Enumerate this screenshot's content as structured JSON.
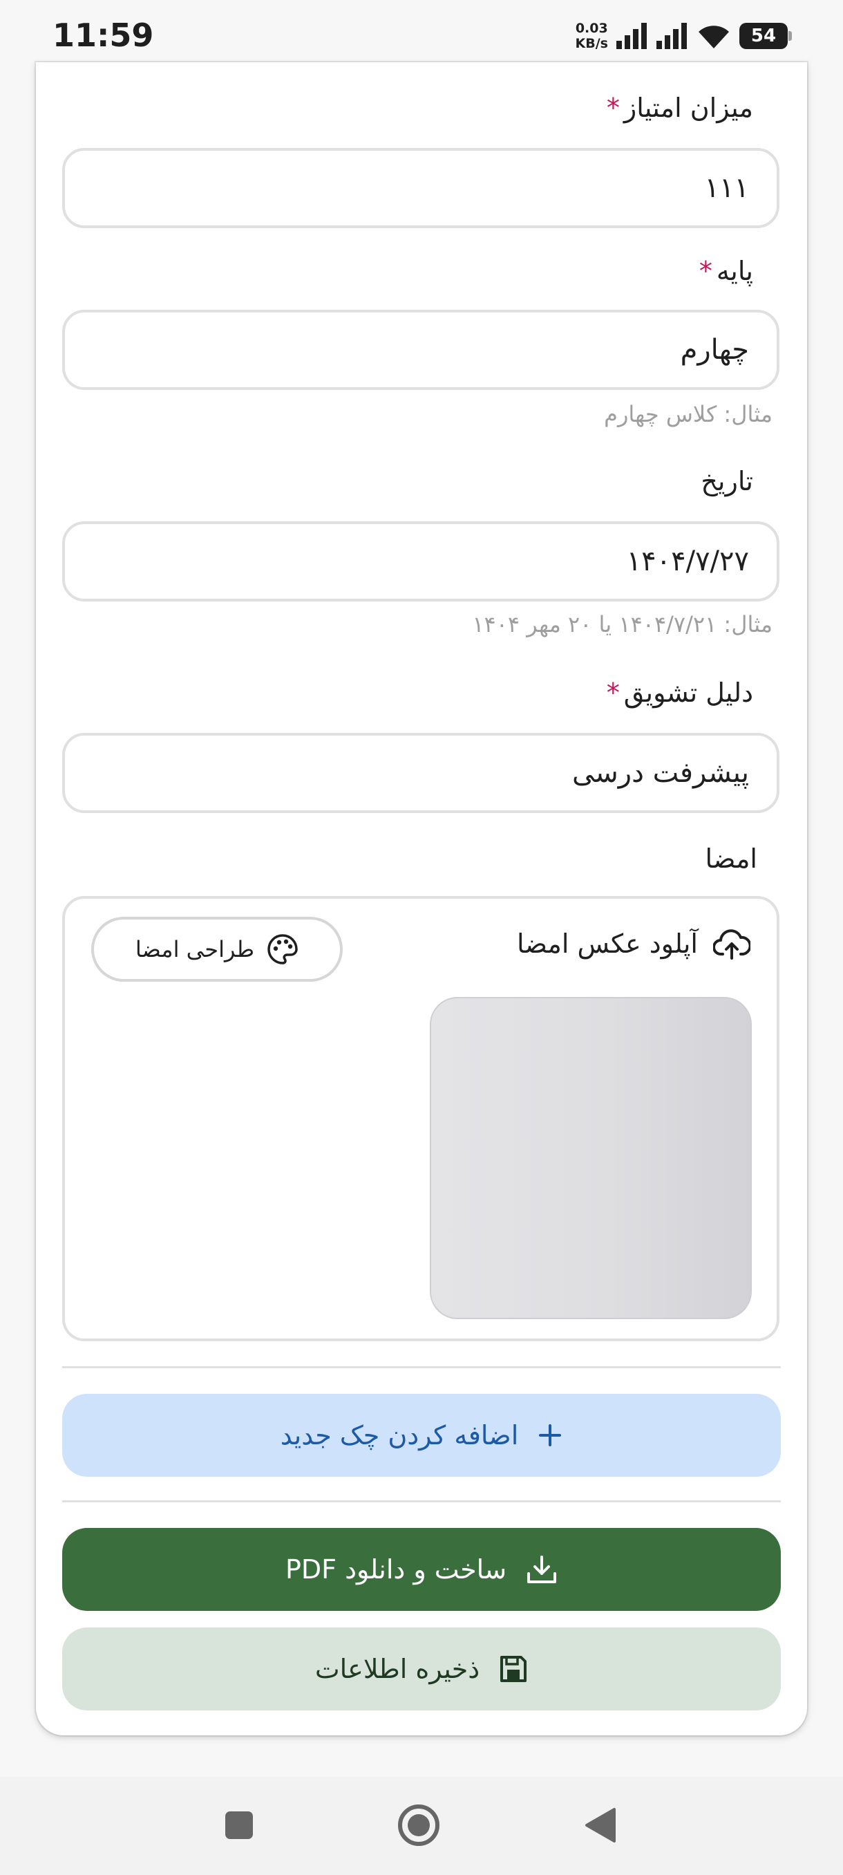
{
  "status_bar": {
    "time": "11:59",
    "net_speed_value": "0.03",
    "net_speed_unit": "KB/s",
    "battery": "54"
  },
  "form": {
    "score": {
      "label": "میزان امتیاز",
      "required_mark": "*",
      "value": "۱۱۱"
    },
    "grade": {
      "label": "پایه",
      "required_mark": "*",
      "value": "چهارم",
      "hint": "مثال: کلاس چهارم"
    },
    "date": {
      "label": "تاریخ",
      "value": "۱۴۰۴/۷/۲۷",
      "hint": "مثال: ۱۴۰۴/۷/۲۱ یا ۲۰ مهر ۱۴۰۴"
    },
    "reason": {
      "label": "دلیل تشویق",
      "required_mark": "*",
      "value": "پیشرفت درسی"
    },
    "signature": {
      "label": "امضا",
      "upload_label": "آپلود عکس امضا",
      "draw_label": "طراحی امضا"
    }
  },
  "actions": {
    "add_check": "اضافه کردن چک جدید",
    "build_pdf": "ساخت و دانلود PDF",
    "save": "ذخیره اطلاعات"
  },
  "icons": {
    "upload": "cloud-upload-icon",
    "palette": "palette-icon",
    "plus": "plus-icon",
    "download": "download-icon",
    "save": "floppy-disk-icon"
  },
  "colors": {
    "required": "#c2185b",
    "add_button_bg": "#cfe2fb",
    "add_button_text": "#1a5aa8",
    "pdf_button_bg": "#3a6e3c",
    "save_button_bg": "#d8e3d9"
  }
}
